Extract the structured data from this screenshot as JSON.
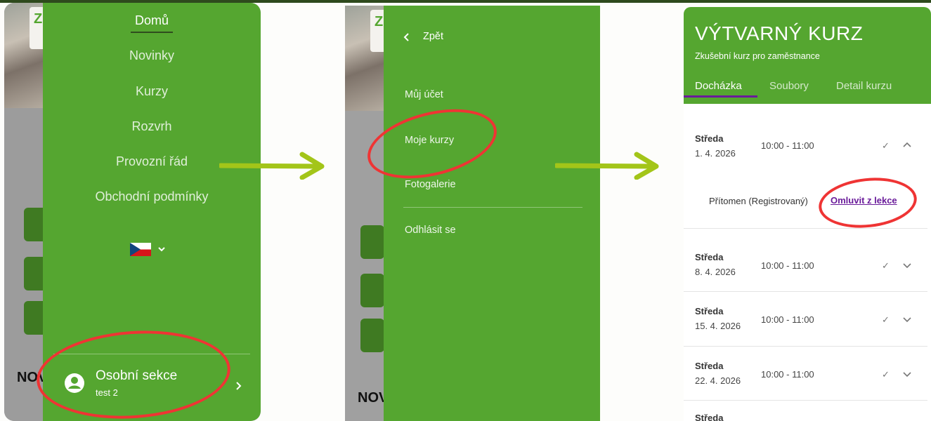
{
  "panel1": {
    "menu": [
      "Domů",
      "Novinky",
      "Kurzy",
      "Rozvrh",
      "Provozní řád",
      "Obchodní podmínky"
    ],
    "bg_fragment": "NOV",
    "personal_section": {
      "title": "Osobní sekce",
      "user": "test 2"
    }
  },
  "panel2": {
    "back_label": "Zpět",
    "menu": [
      "Můj účet",
      "Moje kurzy",
      "Fotogalerie"
    ],
    "logout": "Odhlásit se",
    "bg_fragment": "NOV"
  },
  "panel3": {
    "title": "VÝTVARNÝ KURZ",
    "subtitle": "Zkušební kurz pro zaměstnance",
    "tabs": [
      "Docházka",
      "Soubory",
      "Detail kurzu"
    ],
    "lessons": [
      {
        "day": "Středa",
        "date": "1. 4. 2026",
        "time": "10:00 - 11:00"
      },
      {
        "day": "Středa",
        "date": "8. 4. 2026",
        "time": "10:00 - 11:00"
      },
      {
        "day": "Středa",
        "date": "15. 4. 2026",
        "time": "10:00 - 11:00"
      },
      {
        "day": "Středa",
        "date": "22. 4. 2026",
        "time": "10:00 - 11:00"
      },
      {
        "day": "Středa",
        "date": "",
        "time": ""
      }
    ],
    "status": "Přítomen (Registrovaný)",
    "excuse_link": "Omluvit z lekce"
  },
  "colors": {
    "green": "#55a630",
    "dark_green": "#2f4d1e",
    "annotation_red": "#ef3434",
    "arrow_green": "#a3c519",
    "link_purple": "#6a1b9a"
  }
}
